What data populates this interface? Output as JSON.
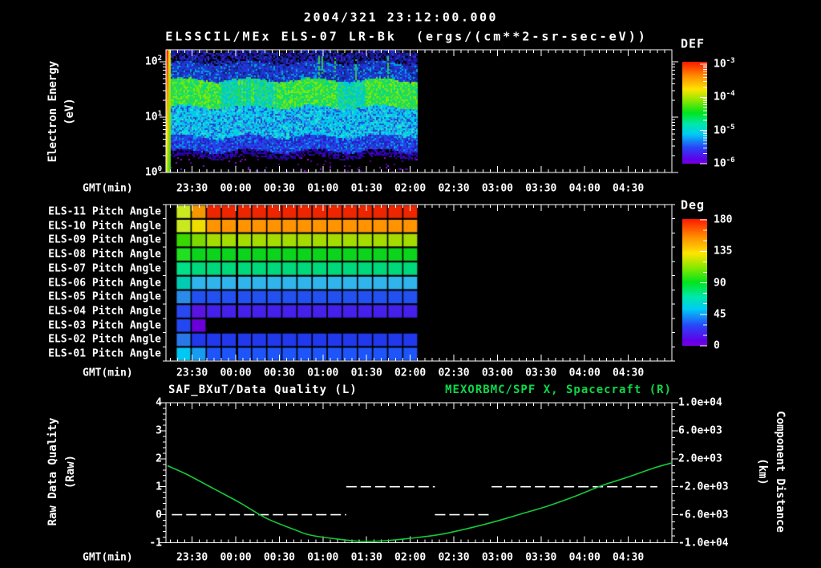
{
  "header": {
    "title": "2004/321 23:12:00.000",
    "subtitle": "ELSSCIL/MEx ELS-07 LR-Bk  (ergs/(cm**2-sr-sec-eV))"
  },
  "time_axis": {
    "label": "GMT(min)",
    "start": "23:12",
    "end": "05:00",
    "major_tick_min": 30,
    "minor_tick_min": 5,
    "ticks": [
      "23:30",
      "00:00",
      "00:30",
      "01:00",
      "01:30",
      "02:00",
      "02:30",
      "03:00",
      "03:30",
      "04:00",
      "04:30"
    ]
  },
  "colors": {
    "background": "#000000",
    "text": "#ffffff",
    "accent_green": "#0ed848",
    "curve_green": "#16c83c",
    "rainbow_stops": [
      [
        "#ff1800",
        0
      ],
      [
        "#ff8c00",
        14
      ],
      [
        "#ffe400",
        27
      ],
      [
        "#8ce800",
        38
      ],
      [
        "#00e41c",
        50
      ],
      [
        "#00e8a8",
        61
      ],
      [
        "#00ccf4",
        71
      ],
      [
        "#2846f8",
        84
      ],
      [
        "#6000e8",
        96
      ],
      [
        "#7a00e4",
        100
      ]
    ]
  },
  "chart_data": [
    {
      "type": "heatmap",
      "name": "electron-energy-spectrogram",
      "ylabel_lines": [
        "Electron Energy",
        "(eV)"
      ],
      "y_scale": "log",
      "yticks": [
        "10^2",
        "10^1",
        "10^0"
      ],
      "colorbar": {
        "title": "DEF",
        "units": "ergs/(cm**2-sr-sec-eV)",
        "ticks": [
          "10^-3",
          "10^-4",
          "10^-5",
          "10^-6"
        ]
      },
      "data_start": "23:12",
      "data_end": "02:05",
      "features": [
        "bright red-orange-yellow stripe at left edge near 23:12",
        "intermittent bright-green vertical streaks",
        "sparse violet speckles below ~2.5 eV",
        "no data after 02:05"
      ],
      "bands": [
        {
          "frac": [
            0.0,
            0.1
          ],
          "desc": "mottled dark blue ~60-160 eV",
          "palette": [
            "#101c8c",
            "#101c8c",
            "#1c2cb4",
            "#000000",
            "#000000",
            "#3a00a8",
            "#2838cc",
            "#101c8c"
          ]
        },
        {
          "frac": [
            0.1,
            0.24
          ],
          "desc": "blue with cyan patches ~30-60 eV",
          "palette": [
            "#2038d8",
            "#2038d8",
            "#1a2cb0",
            "#102080",
            "#2038d8",
            "#00a0e0"
          ]
        },
        {
          "frac": [
            0.24,
            0.46
          ],
          "desc": "bright green band ~10-30 eV",
          "palette": [
            "#28dc50",
            "#28dc50",
            "#66ea1c",
            "#00d890",
            "#8ae800",
            "#28dc50"
          ],
          "palette_weak": [
            "#00ccb8",
            "#20d8a0",
            "#00c8e0",
            "#28dc50"
          ]
        },
        {
          "frac": [
            0.46,
            0.7
          ],
          "desc": "cyan ~4-10 eV",
          "palette": [
            "#00cce8",
            "#00cce8",
            "#28e0d0",
            "#2f80e8",
            "#00cce8",
            "#2048d8"
          ]
        },
        {
          "frac": [
            0.7,
            0.82
          ],
          "desc": "blue ~3-4 eV",
          "palette": [
            "#2345e8",
            "#2345e8",
            "#1a2cb4",
            "#00a0e8",
            "#3a10d0",
            "#2345e8"
          ]
        },
        {
          "frac": [
            0.82,
            0.875
          ],
          "desc": "dark indigo lower edge",
          "palette": [
            "#2600b0",
            "#1a1268",
            "#000000",
            "#2600b0",
            "#4a00c8",
            "#000000"
          ]
        },
        {
          "frac": [
            0.875,
            1.0
          ],
          "desc": "black with sparse violet speckles",
          "palette": [
            "#000000"
          ],
          "speckle": [
            "#8a10d8",
            "#5a00a0"
          ],
          "speckle_p": 0.045
        }
      ],
      "left_stripe": [
        [
          "#ff2000",
          "#ff8c00",
          "#ffd800",
          "#b0e000"
        ],
        [
          "#e8e000",
          "#98e000",
          "#50d820"
        ]
      ]
    },
    {
      "type": "heatmap",
      "name": "pitch-angle-rows",
      "colorbar": {
        "title": "Deg",
        "ticks": [
          "180",
          "135",
          "90",
          "45",
          "0"
        ]
      },
      "data_start": "23:12",
      "data_end": "02:05",
      "columns": 16,
      "rows": [
        {
          "label": "ELS-11 Pitch Angle",
          "value_deg_approx": 170,
          "lead_colors": [
            "#c8e820",
            "#f59800"
          ],
          "color": "#ee2600",
          "end": "02:05"
        },
        {
          "label": "ELS-10 Pitch Angle",
          "value_deg_approx": 150,
          "lead_colors": [
            "#c8e820",
            "#eede00"
          ],
          "color": "#ff9400",
          "end": "02:05"
        },
        {
          "label": "ELS-09 Pitch Angle",
          "value_deg_approx": 130,
          "lead_colors": [
            "#38d800",
            "#7cd800"
          ],
          "color": "#a4dc00",
          "end": "02:05"
        },
        {
          "label": "ELS-08 Pitch Angle",
          "value_deg_approx": 110,
          "lead_colors": [
            "#20e020"
          ],
          "color": "#0cd41c",
          "end": "02:05"
        },
        {
          "label": "ELS-07 Pitch Angle",
          "value_deg_approx": 95,
          "lead_colors": [
            "#00e088"
          ],
          "color": "#00d87c",
          "end": "02:05"
        },
        {
          "label": "ELS-06 Pitch Angle",
          "value_deg_approx": 75,
          "lead_colors": [
            "#00ccb4"
          ],
          "color": "#30b4ec",
          "end": "02:05"
        },
        {
          "label": "ELS-05 Pitch Angle",
          "value_deg_approx": 50,
          "lead_colors": [
            "#2a8ce8"
          ],
          "color": "#2350f0",
          "end": "02:05"
        },
        {
          "label": "ELS-04 Pitch Angle",
          "value_deg_approx": 30,
          "lead_colors": [
            "#2a48f0",
            "#5a14e0"
          ],
          "color": "#4420ea",
          "end": "02:05"
        },
        {
          "label": "ELS-03 Pitch Angle",
          "value_deg_approx": 20,
          "lead_colors": [
            "#2347f0",
            "#6a00d8"
          ],
          "color": null,
          "end": "23:40"
        },
        {
          "label": "ELS-02 Pitch Angle",
          "value_deg_approx": 45,
          "lead_colors": [
            "#2a78e8"
          ],
          "color": "#2238ec",
          "end": "02:05"
        },
        {
          "label": "ELS-01 Pitch Angle",
          "value_deg_approx": 55,
          "lead_colors": [
            "#00c8f4",
            "#189cf2"
          ],
          "color": "#1e55fa",
          "end": "02:05"
        }
      ]
    },
    {
      "type": "line",
      "name": "quality-and-distance",
      "title_left": "SAF_BXuT/Data Quality (L)",
      "title_right": "MEXORBMC/SPF X, Spacecraft (R)",
      "left_axis": {
        "label_lines": [
          "Raw Data Quality",
          "(Raw)"
        ],
        "ticks": [
          "4",
          "3",
          "2",
          "1",
          "0",
          "-1"
        ],
        "range": [
          4,
          -1
        ]
      },
      "right_axis": {
        "label_lines": [
          "Component Distance",
          "(km)"
        ],
        "ticks": [
          "1.0e+04",
          "6.0e+03",
          "2.0e+03",
          "-2.0e+03",
          "-6.0e+03",
          "-1.0e+04"
        ],
        "range": [
          10000,
          -10000
        ]
      },
      "series": [
        {
          "name": "SAF_BXuT/Data Quality",
          "axis": "left",
          "color": "#ffffff",
          "style": "dashed",
          "segments": [
            {
              "value": 0,
              "from": "23:16",
              "to": "01:16"
            },
            {
              "value": 1,
              "from": "01:16",
              "to": "02:17"
            },
            {
              "value": 0,
              "from": "02:17",
              "to": "02:56"
            },
            {
              "value": 1,
              "from": "02:56",
              "to": "04:50"
            }
          ]
        },
        {
          "name": "MEXORBMC/SPF X Spacecraft",
          "axis": "right",
          "color": "#16c83c",
          "style": "solid",
          "points": [
            [
              "23:13",
              1000
            ],
            [
              "23:26",
              -200
            ],
            [
              "23:45",
              -2300
            ],
            [
              "00:03",
              -4300
            ],
            [
              "00:21",
              -6500
            ],
            [
              "00:40",
              -8100
            ],
            [
              "00:51",
              -8900
            ],
            [
              "01:07",
              -9400
            ],
            [
              "01:26",
              -9800
            ],
            [
              "01:44",
              -9700
            ],
            [
              "02:03",
              -9300
            ],
            [
              "02:21",
              -8800
            ],
            [
              "02:39",
              -8000
            ],
            [
              "02:58",
              -7000
            ],
            [
              "03:16",
              -5900
            ],
            [
              "03:34",
              -4800
            ],
            [
              "03:53",
              -3400
            ],
            [
              "04:11",
              -1900
            ],
            [
              "04:30",
              -600
            ],
            [
              "04:48",
              700
            ],
            [
              "05:00",
              1400
            ]
          ]
        }
      ]
    }
  ]
}
